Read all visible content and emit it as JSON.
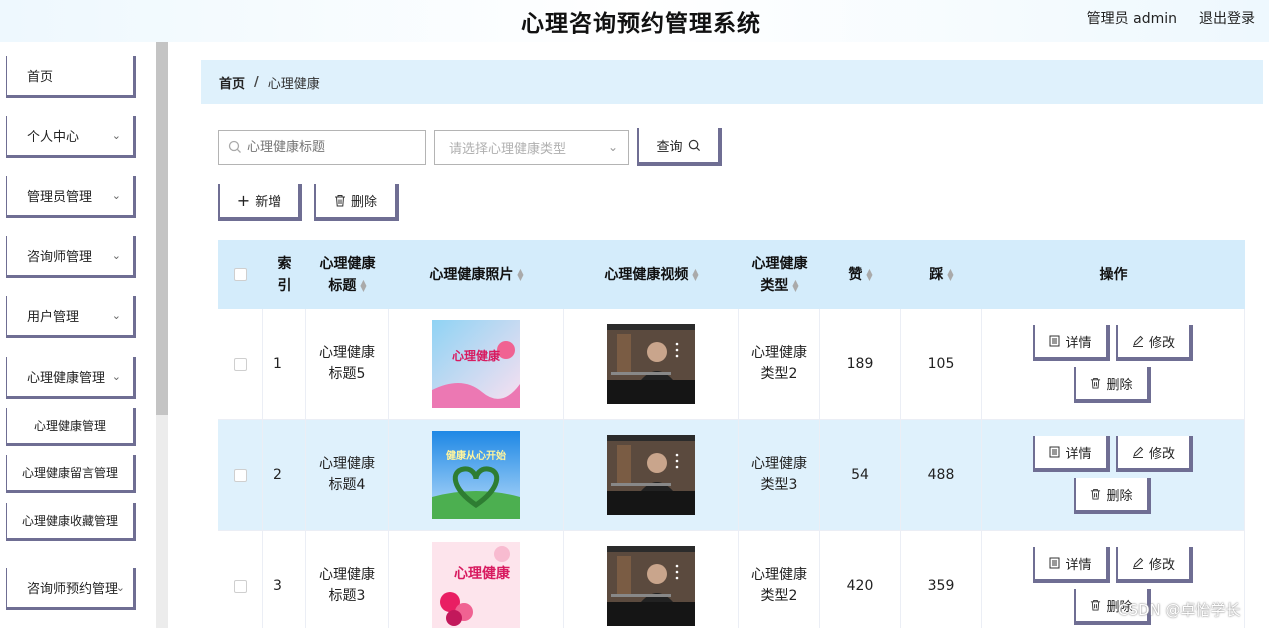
{
  "header": {
    "title": "心理咨询预约管理系统",
    "user": "管理员 admin",
    "logout": "退出登录"
  },
  "sidebar": {
    "items": [
      {
        "label": "首页",
        "has_arrow": false
      },
      {
        "label": "个人中心",
        "has_arrow": true
      },
      {
        "label": "管理员管理",
        "has_arrow": true
      },
      {
        "label": "咨询师管理",
        "has_arrow": true
      },
      {
        "label": "用户管理",
        "has_arrow": true
      },
      {
        "label": "心理健康管理",
        "has_arrow": true
      },
      {
        "label": "心理健康管理",
        "has_arrow": false
      },
      {
        "label": "心理健康留言管理",
        "has_arrow": false
      },
      {
        "label": "心理健康收藏管理",
        "has_arrow": false
      },
      {
        "label": "咨询师预约管理",
        "has_arrow": true
      }
    ]
  },
  "breadcrumb": {
    "home": "首页",
    "separator": "/",
    "current": "心理健康"
  },
  "search": {
    "title_placeholder": "心理健康标题",
    "type_placeholder": "请选择心理健康类型",
    "query_label": "查询"
  },
  "actions": {
    "add_label": "新增",
    "delete_label": "删除"
  },
  "table": {
    "columns": {
      "index": "索引",
      "title": "心理健康标题",
      "photo": "心理健康照片",
      "video": "心理健康视频",
      "type": "心理健康类型",
      "likes": "赞",
      "dislikes": "踩",
      "ops": "操作"
    },
    "rows": [
      {
        "index": "1",
        "title": "心理健康标题5",
        "photo_text": "心理健康",
        "type": "心理健康类型2",
        "likes": "189",
        "dislikes": "105"
      },
      {
        "index": "2",
        "title": "心理健康标题4",
        "photo_text": "健康从心开始",
        "type": "心理健康类型3",
        "likes": "54",
        "dislikes": "488"
      },
      {
        "index": "3",
        "title": "心理健康标题3",
        "photo_text": "心理健康",
        "type": "心理健康类型2",
        "likes": "420",
        "dislikes": "359"
      }
    ],
    "ops": {
      "detail": "详情",
      "edit": "修改",
      "delete": "删除"
    }
  },
  "watermark": "CSDN @卓怡学长",
  "colors": {
    "accent_border": "#6f6e93",
    "header_bg": "#d4ecfb",
    "stripe_bg": "#dff1fc"
  }
}
